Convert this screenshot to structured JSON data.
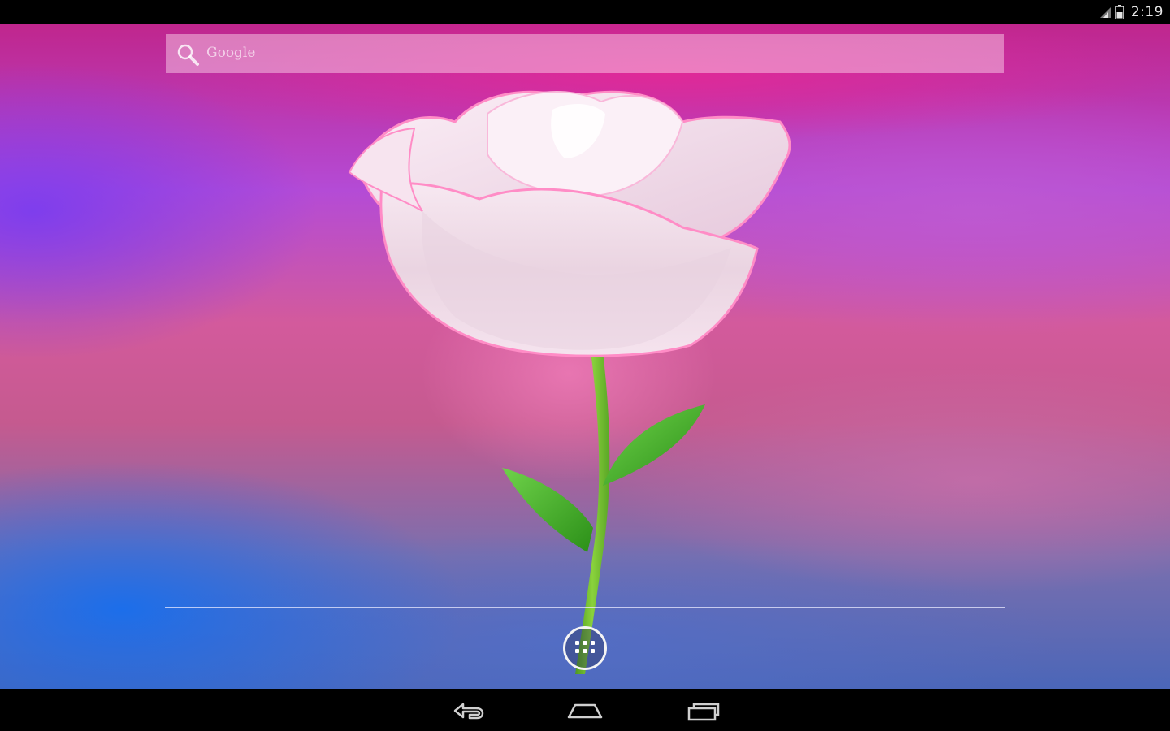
{
  "status_bar": {
    "time": "2:19",
    "icons": [
      "signal-icon",
      "battery-icon"
    ]
  },
  "search": {
    "label": "Google",
    "icon": "search-icon"
  },
  "wallpaper": {
    "subject": "rose-live-wallpaper",
    "colors": {
      "top": "#c0268d",
      "left": "#7a3cf0",
      "bottom_left": "#146ef0",
      "petal": "#f4d9ea",
      "petal_edge": "#ff7ac0",
      "stem": "#6dbb2e",
      "leaf": "#3eae22"
    }
  },
  "dock": {
    "all_apps_icon": "all-apps-icon"
  },
  "nav_bar": {
    "back_icon": "back-icon",
    "home_icon": "home-icon",
    "recents_icon": "recents-icon"
  }
}
